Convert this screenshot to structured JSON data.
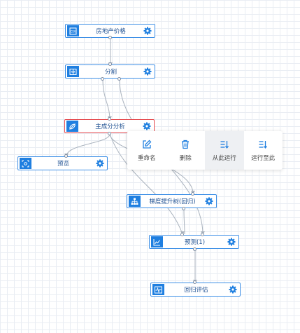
{
  "nodes": [
    {
      "id": "house_price",
      "label": "房地产价格",
      "icon": "dataset-icon"
    },
    {
      "id": "split",
      "label": "分割",
      "icon": "split-icon"
    },
    {
      "id": "pca",
      "label": "主成分分析",
      "icon": "pca-icon",
      "selected": true
    },
    {
      "id": "preview",
      "label": "预览",
      "icon": "preview-icon"
    },
    {
      "id": "gbrt",
      "label": "梯度提升树(回归)",
      "icon": "tree-icon"
    },
    {
      "id": "predict",
      "label": "预测(1)",
      "icon": "chart-icon"
    },
    {
      "id": "eval",
      "label": "回归评估",
      "icon": "evaluate-icon"
    }
  ],
  "context_menu": {
    "items": [
      {
        "label": "重命名",
        "icon": "edit-icon"
      },
      {
        "label": "删除",
        "icon": "trash-icon"
      },
      {
        "label": "从此运行",
        "icon": "run-from-here-icon",
        "active": true
      },
      {
        "label": "运行至此",
        "icon": "run-to-here-icon"
      }
    ]
  },
  "colors": {
    "node_border": "#3d8fe6",
    "icon_bg": "#1f7fe0",
    "selected_border": "#e5484d",
    "edge": "#a9b2bd",
    "gear": "#1f7fe0"
  }
}
